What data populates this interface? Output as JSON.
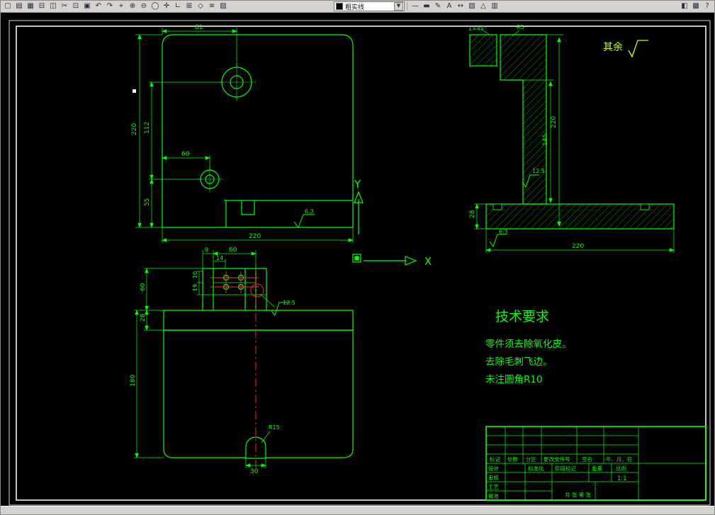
{
  "toolbar": {
    "icons_left": [
      {
        "name": "new",
        "glyph": "▢"
      },
      {
        "name": "open",
        "glyph": "▤"
      },
      {
        "name": "save",
        "glyph": "▦"
      },
      {
        "name": "print",
        "glyph": "⊟"
      },
      {
        "name": "preview",
        "glyph": "◫"
      },
      {
        "name": "cut",
        "glyph": "✂"
      },
      {
        "name": "copy",
        "glyph": "⊡"
      },
      {
        "name": "paste",
        "glyph": "▣"
      },
      {
        "name": "undo",
        "glyph": "↶"
      },
      {
        "name": "redo",
        "glyph": "↷"
      },
      {
        "name": "zoom-window",
        "glyph": "⌖"
      },
      {
        "name": "zoom-in",
        "glyph": "⊕"
      },
      {
        "name": "zoom-out",
        "glyph": "⊖"
      },
      {
        "name": "zoom-extents",
        "glyph": "◯"
      },
      {
        "name": "pan",
        "glyph": "✛"
      },
      {
        "name": "ortho",
        "glyph": "∟"
      },
      {
        "name": "grid",
        "glyph": "⊞"
      },
      {
        "name": "osnap",
        "glyph": "◇"
      },
      {
        "name": "layers",
        "glyph": "≡"
      },
      {
        "name": "color",
        "glyph": "▨"
      }
    ],
    "icons_right": [
      {
        "name": "linetype",
        "glyph": "—"
      },
      {
        "name": "lineweight",
        "glyph": "▬"
      },
      {
        "name": "edit",
        "glyph": "✎"
      },
      {
        "name": "text",
        "glyph": "A"
      },
      {
        "name": "dimension",
        "glyph": "↔"
      },
      {
        "name": "hatch",
        "glyph": "▧"
      },
      {
        "name": "angle",
        "glyph": "△"
      },
      {
        "name": "image",
        "glyph": "▥"
      }
    ],
    "icons_far": [
      {
        "name": "properties",
        "glyph": "◧"
      },
      {
        "name": "palette",
        "glyph": "▩"
      },
      {
        "name": "help",
        "glyph": "?"
      }
    ],
    "layer_combo": {
      "value": "粗实线"
    }
  },
  "drawing": {
    "axis": {
      "x": "X",
      "y": "Y"
    },
    "surplus_label": "其余",
    "tech_requirements": {
      "title": "技术要求",
      "lines": [
        "零件须去除氧化皮。",
        "去除毛刺飞边。",
        "未注圆角R10"
      ]
    },
    "dims": {
      "tl": [
        "81",
        "220",
        "112",
        "55",
        "60",
        "220",
        "6.3"
      ],
      "tr": [
        "1×45°",
        "R5",
        "220",
        "145",
        "28",
        "220",
        "6.3",
        "12.5"
      ],
      "bl": [
        "60",
        "9",
        "14",
        "10",
        "19",
        "60",
        "28",
        "180",
        "12.5",
        "R15",
        "30"
      ]
    },
    "colors": {
      "line": "#00ff00",
      "centerline": "#ff3030",
      "frame": "#d8d8d8",
      "background": "#000000",
      "note": "#c8ff00"
    }
  },
  "title_block": {
    "cells": [
      "标记",
      "处数",
      "分区",
      "更改文件号",
      "签名",
      "年、月、日",
      "设计",
      "审核",
      "工艺",
      "批准",
      "标准化",
      "阶段标记",
      "重量",
      "比例",
      "1:1",
      "共 张 第 张"
    ]
  }
}
